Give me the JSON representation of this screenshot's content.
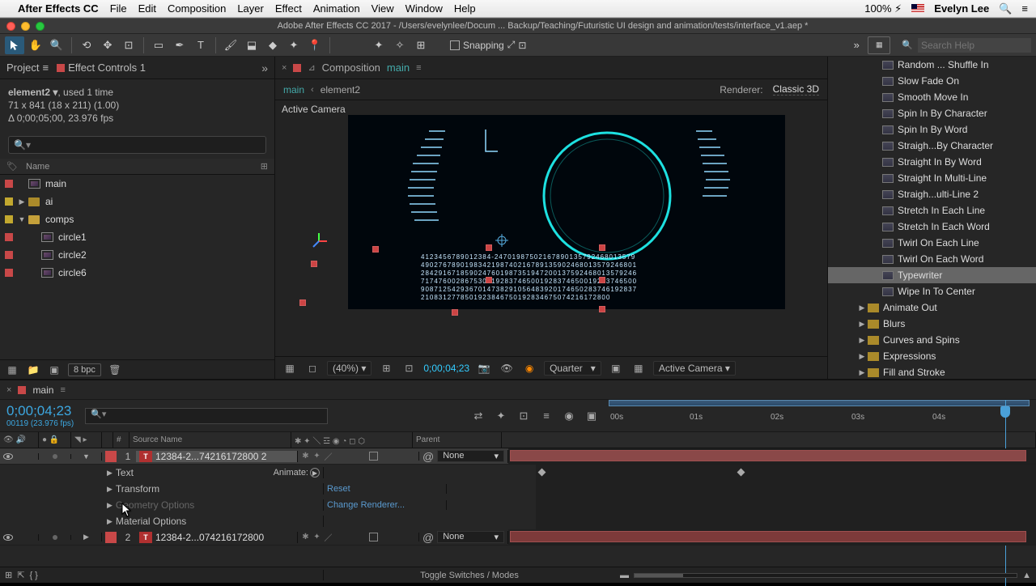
{
  "menubar": {
    "app": "After Effects CC",
    "items": [
      "File",
      "Edit",
      "Composition",
      "Layer",
      "Effect",
      "Animation",
      "View",
      "Window",
      "Help"
    ],
    "battery": "100%",
    "user": "Evelyn Lee"
  },
  "titlebar": "Adobe After Effects CC 2017 - /Users/evelynlee/Docum ... Backup/Teaching/Futuristic UI design and animation/tests/interface_v1.aep *",
  "toolbar": {
    "snapping": "Snapping",
    "search_ph": "Search Help"
  },
  "projectPanel": {
    "tab1": "Project",
    "tab2": "Effect Controls 1",
    "asset_name": "element2 ▾",
    "asset_used": ", used 1 time",
    "asset_dim": "71 x 841  (18 x 211) (1.00)",
    "asset_dur": "Δ 0;00;05;00, 23.976 fps",
    "col_name": "Name",
    "items": [
      {
        "type": "comp",
        "name": "main",
        "indent": 0,
        "color": "#c84848",
        "twirl": ""
      },
      {
        "type": "folder",
        "name": "ai",
        "indent": 0,
        "color": "#c2a82f",
        "twirl": "▶"
      },
      {
        "type": "folder",
        "name": "comps",
        "indent": 0,
        "color": "#c2a82f",
        "twirl": "▼",
        "open": true
      },
      {
        "type": "comp",
        "name": "circle1",
        "indent": 1,
        "color": "#c84848",
        "twirl": ""
      },
      {
        "type": "comp",
        "name": "circle2",
        "indent": 1,
        "color": "#c84848",
        "twirl": ""
      },
      {
        "type": "comp",
        "name": "circle6",
        "indent": 1,
        "color": "#c84848",
        "twirl": ""
      }
    ],
    "bpc": "8 bpc"
  },
  "compPanel": {
    "label": "Composition",
    "current": "main",
    "bc1": "main",
    "bc2": "element2",
    "renderer_lbl": "Renderer:",
    "renderer_val": "Classic 3D",
    "active_camera": "Active Camera",
    "zoom": "(40%)",
    "time": "0;00;04;23",
    "quality": "Quarter",
    "camera_sel": "Active Camera"
  },
  "presets": {
    "list": [
      {
        "name": "Random ... Shuffle In",
        "type": "preset"
      },
      {
        "name": "Slow Fade On",
        "type": "preset"
      },
      {
        "name": "Smooth Move In",
        "type": "preset"
      },
      {
        "name": "Spin In By Character",
        "type": "preset"
      },
      {
        "name": "Spin In By Word",
        "type": "preset"
      },
      {
        "name": "Straigh...By Character",
        "type": "preset"
      },
      {
        "name": "Straight In By Word",
        "type": "preset"
      },
      {
        "name": "Straight In Multi-Line",
        "type": "preset"
      },
      {
        "name": "Straigh...ulti-Line 2",
        "type": "preset"
      },
      {
        "name": "Stretch In Each Line",
        "type": "preset"
      },
      {
        "name": "Stretch In Each Word",
        "type": "preset"
      },
      {
        "name": "Twirl On Each Line",
        "type": "preset"
      },
      {
        "name": "Twirl On Each Word",
        "type": "preset"
      },
      {
        "name": "Typewriter",
        "type": "preset",
        "sel": true
      },
      {
        "name": "Wipe In To Center",
        "type": "preset"
      },
      {
        "name": "Animate Out",
        "type": "folder"
      },
      {
        "name": "Blurs",
        "type": "folder"
      },
      {
        "name": "Curves and Spins",
        "type": "folder"
      },
      {
        "name": "Expressions",
        "type": "folder"
      },
      {
        "name": "Fill and Stroke",
        "type": "folder"
      }
    ]
  },
  "timeline": {
    "tab": "main",
    "time": "0;00;04;23",
    "fps": "00119 (23.976 fps)",
    "ruler": [
      "00s",
      "01s",
      "02s",
      "03s",
      "04s"
    ],
    "head_source": "Source Name",
    "head_num": "#",
    "head_parent": "Parent",
    "layer1": {
      "num": "1",
      "name": "12384-2...74216172800 2",
      "parent": "None"
    },
    "layer2": {
      "num": "2",
      "name": "12384-2...074216172800",
      "parent": "None"
    },
    "props": [
      {
        "name": "Text",
        "val": "",
        "animate": "Animate:"
      },
      {
        "name": "Transform",
        "val": "Reset"
      },
      {
        "name": "Geometry Options",
        "val": "Change Renderer...",
        "dim": true
      },
      {
        "name": "Material Options",
        "val": ""
      }
    ],
    "toggle": "Toggle Switches / Modes"
  }
}
